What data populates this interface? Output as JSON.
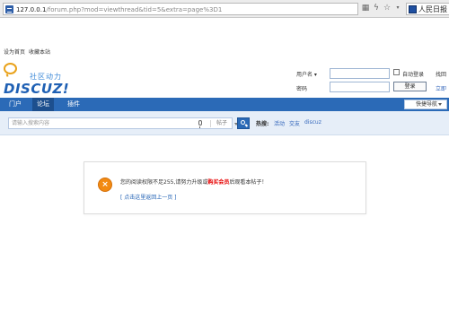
{
  "browser": {
    "url_host": "127.0.0.1",
    "url_path": "/forum.php?mod=viewthread&tid=5&extra=page%3D1",
    "search_engine_text": "人民日报"
  },
  "toplinks": {
    "set_home": "设为首页",
    "bookmark": "收藏本站"
  },
  "logo": {
    "sub": "社区动力",
    "main": "DISCUZ!"
  },
  "login": {
    "username_label": "用户名",
    "password_label": "密码",
    "autologin_label": "自动登录",
    "retrieve_password": "找回",
    "login_button": "登录",
    "register": "立即"
  },
  "nav": {
    "items": [
      "门户",
      "论坛",
      "插件"
    ],
    "quick_nav": "快捷导航"
  },
  "search": {
    "placeholder": "请输入搜索内容",
    "type": "帖子",
    "hot_label": "热搜:",
    "hot_items": [
      "活动",
      "交友",
      "discuz"
    ]
  },
  "message": {
    "text_before": "您的阅读权限不足255,请努力升级或",
    "highlight": "购买会员",
    "text_after": "后观看本帖子！",
    "back_link": "[ 点击这里返回上一页 ]"
  },
  "colors": {
    "brand_blue": "#2b6ab7",
    "error_orange": "#f28a12",
    "highlight_red": "#e60000"
  }
}
